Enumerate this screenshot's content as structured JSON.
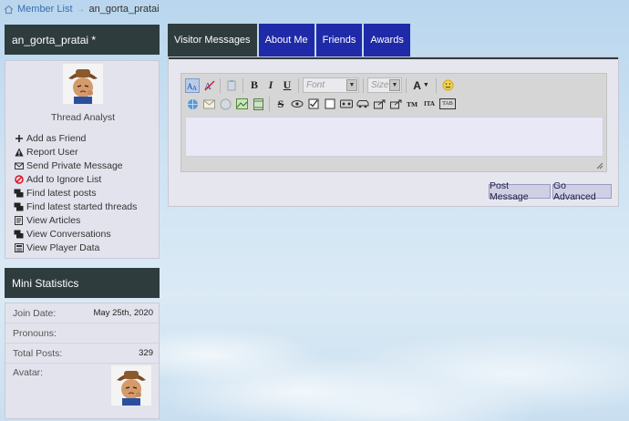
{
  "breadcrumb": {
    "member_list": "Member List",
    "separator": "→",
    "current": "an_gorta_pratai"
  },
  "profile": {
    "username": "an_gorta_pratai *",
    "usertitle": "Thread Analyst",
    "avatar_icon": "cartoon-cowboy-avatar",
    "actions": [
      {
        "label": "Add as Friend",
        "icon": "plus-icon"
      },
      {
        "label": "Report User",
        "icon": "warning-icon"
      },
      {
        "label": "Send Private Message",
        "icon": "envelope-icon"
      },
      {
        "label": "Add to Ignore List",
        "icon": "block-icon"
      },
      {
        "label": "Find latest posts",
        "icon": "posts-icon"
      },
      {
        "label": "Find latest started threads",
        "icon": "threads-icon"
      },
      {
        "label": "View Articles",
        "icon": "document-icon"
      },
      {
        "label": "View Conversations",
        "icon": "conversation-icon"
      },
      {
        "label": "View Player Data",
        "icon": "data-icon"
      }
    ]
  },
  "stats": {
    "title": "Mini Statistics",
    "rows": [
      {
        "label": "Join Date:",
        "value": "May 25th, 2020"
      },
      {
        "label": "Pronouns:",
        "value": ""
      },
      {
        "label": "Total Posts:",
        "value": "329"
      },
      {
        "label": "Avatar:",
        "value": ""
      }
    ]
  },
  "tabs": [
    {
      "label": "Visitor Messages",
      "active": true
    },
    {
      "label": "About Me",
      "active": false
    },
    {
      "label": "Friends",
      "active": false
    },
    {
      "label": "Awards",
      "active": false
    }
  ],
  "editor": {
    "font_placeholder": "Font",
    "size_placeholder": "Size",
    "bold": "B",
    "italic": "I",
    "underline": "U",
    "text_color": "A",
    "strike": "S",
    "tm": "TM",
    "ita": "ITA",
    "tab": "TAB"
  },
  "buttons": {
    "post": "Post Message",
    "advanced": "Go Advanced"
  },
  "colors": {
    "header": "#2f3c3e",
    "tab": "#1f2aa8",
    "panel": "#e3e3ed",
    "link": "#3a6cb0"
  }
}
